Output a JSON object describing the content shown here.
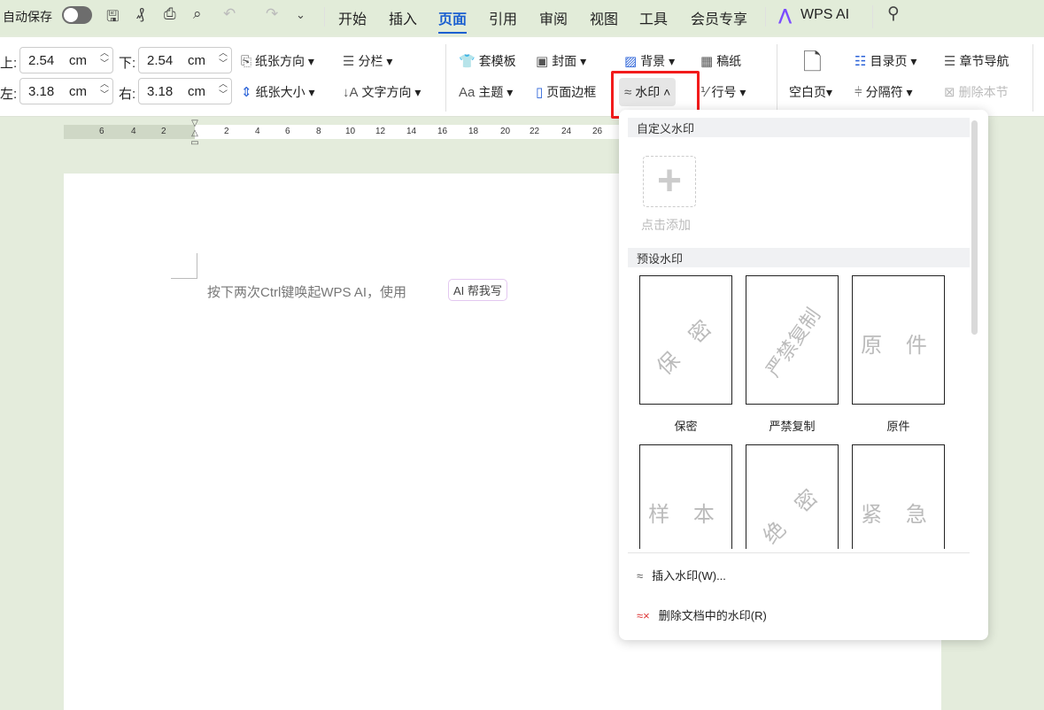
{
  "titlebar": {
    "autosave_label": "自动保存",
    "autosave_on": false,
    "tabs": [
      "开始",
      "插入",
      "页面",
      "引用",
      "审阅",
      "视图",
      "工具",
      "会员专享"
    ],
    "active_tab": "页面",
    "ai_label": "WPS AI"
  },
  "margins": {
    "top_label": "上:",
    "top_value": "2.54",
    "bottom_label": "下:",
    "bottom_value": "2.54",
    "left_label": "左:",
    "left_value": "3.18",
    "right_label": "右:",
    "right_value": "3.18",
    "unit": "cm"
  },
  "ribbon": {
    "orientation": "纸张方向",
    "columns": "分栏",
    "size": "纸张大小",
    "text_direction": "文字方向",
    "template": "套模板",
    "theme": "主题",
    "cover": "封面",
    "border": "页面边框",
    "background": "背景",
    "watermark": "水印",
    "manuscript": "稿纸",
    "line_number": "行号",
    "blank_page": "空白页",
    "toc_page": "目录页",
    "separator": "分隔符",
    "chapter_nav": "章节导航",
    "delete_section": "删除本节"
  },
  "ruler": {
    "left": [
      "6",
      "4",
      "2"
    ],
    "right": [
      "2",
      "4",
      "6",
      "8",
      "10",
      "12",
      "14",
      "16",
      "18",
      "20",
      "22",
      "24",
      "26"
    ]
  },
  "document": {
    "hint": "按下两次Ctrl键唤起WPS AI，使用",
    "ai_button": "AI 帮我写"
  },
  "watermark_menu": {
    "custom_header": "自定义水印",
    "add_label": "点击添加",
    "preset_header": "预设水印",
    "presets": [
      {
        "name": "保密",
        "text": "保 密",
        "rotated": true
      },
      {
        "name": "严禁复制",
        "text": "严禁复制",
        "rotated": true
      },
      {
        "name": "原件",
        "text": "原 件",
        "rotated": false
      },
      {
        "name": "",
        "text": "样 本",
        "rotated": false
      },
      {
        "name": "",
        "text": "绝 密",
        "rotated": true
      },
      {
        "name": "",
        "text": "紧 急",
        "rotated": false
      }
    ],
    "insert": "插入水印(W)...",
    "delete": "删除文档中的水印(R)"
  },
  "colors": {
    "accent": "#1a5fd0",
    "highlight": "#f21b1b"
  }
}
